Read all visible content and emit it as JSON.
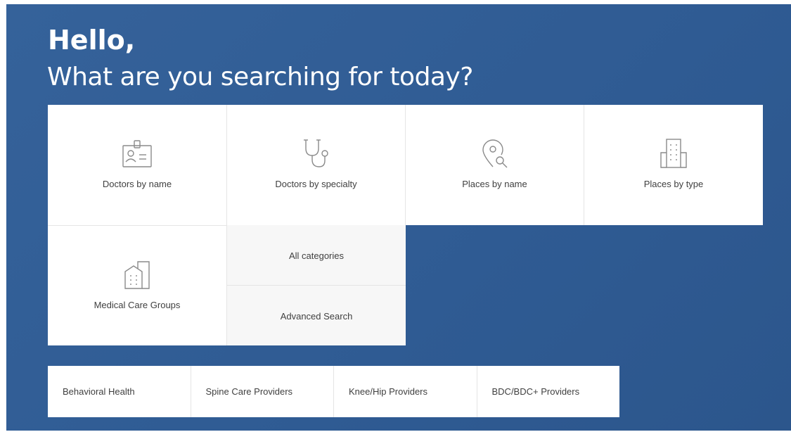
{
  "greeting": "Hello,",
  "question": "What are you searching for today?",
  "tiles": [
    {
      "label": "Doctors by name",
      "icon": "id-badge-icon"
    },
    {
      "label": "Doctors by specialty",
      "icon": "stethoscope-icon"
    },
    {
      "label": "Places by name",
      "icon": "location-search-icon"
    },
    {
      "label": "Places by type",
      "icon": "building-icon"
    },
    {
      "label": "Medical Care Groups",
      "icon": "medical-group-building-icon"
    }
  ],
  "links": {
    "all_categories": "All categories",
    "advanced_search": "Advanced Search"
  },
  "quick_links": [
    "Behavioral Health",
    "Spine Care Providers",
    "Knee/Hip Providers",
    "BDC/BDC+ Providers"
  ],
  "colors": {
    "background": "#2f5b93",
    "tile": "#ffffff",
    "tile_gray": "#f7f7f7",
    "text": "#3f3f3f"
  }
}
